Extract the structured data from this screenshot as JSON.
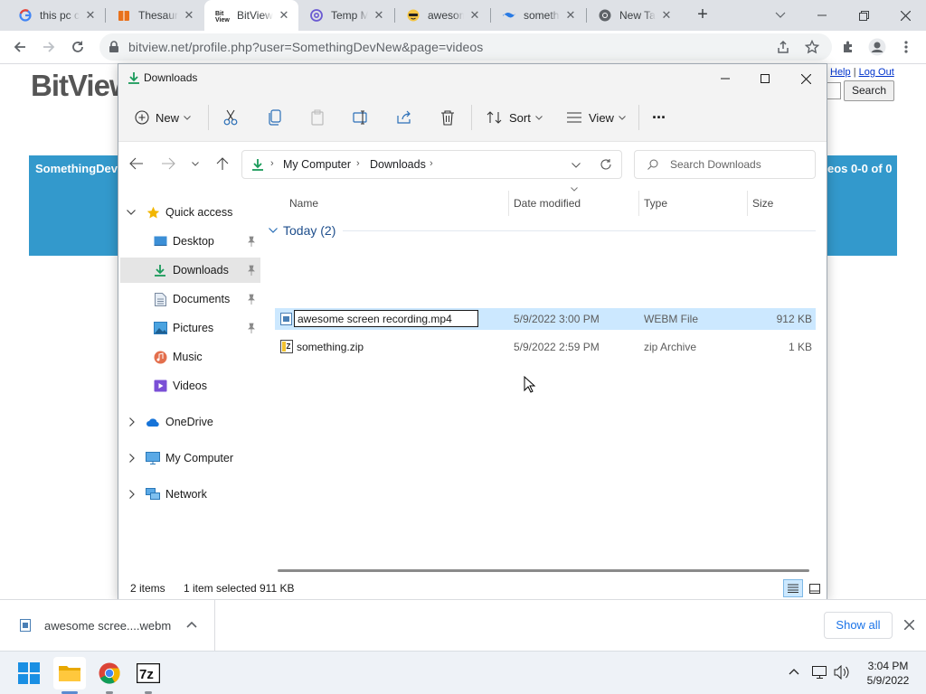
{
  "browser": {
    "tabs": [
      {
        "title": "this pc c",
        "icon": "google-icon"
      },
      {
        "title": "Thesaur",
        "icon": "thesaurus-icon"
      },
      {
        "title": "BitView",
        "icon": "bitview-icon",
        "active": true
      },
      {
        "title": "Temp M",
        "icon": "temp-mail-icon"
      },
      {
        "title": "awesom",
        "icon": "emoji-icon"
      },
      {
        "title": "someth",
        "icon": "swirl-icon"
      },
      {
        "title": "New Tab",
        "icon": "chrome-icon"
      }
    ],
    "new_tab_label": "+",
    "url": "bitview.net/profile.php?user=SomethingDevNew&page=videos"
  },
  "website": {
    "logo": "BitView",
    "help": "Help",
    "separator": "|",
    "logout": "Log Out",
    "search_button": "Search",
    "channel_name": "SomethingDev",
    "videos_count": "eos 0-0 of 0"
  },
  "explorer": {
    "title": "Downloads",
    "commands": {
      "new": "New",
      "sort": "Sort",
      "view": "View",
      "more": "···"
    },
    "breadcrumb": [
      "My Computer",
      "Downloads"
    ],
    "search_placeholder": "Search Downloads",
    "nav": {
      "quick_access": "Quick access",
      "items": [
        "Desktop",
        "Downloads",
        "Documents",
        "Pictures",
        "Music",
        "Videos"
      ],
      "onedrive": "OneDrive",
      "my_computer": "My Computer",
      "network": "Network"
    },
    "columns": {
      "name": "Name",
      "date": "Date modified",
      "type": "Type",
      "size": "Size"
    },
    "group": "Today (2)",
    "files": [
      {
        "name": "awesome screen recording.mp4",
        "date": "5/9/2022 3:00 PM",
        "type": "WEBM File",
        "size": "912 KB",
        "selected": true,
        "renaming": true
      },
      {
        "name": "something.zip",
        "date": "5/9/2022 2:59 PM",
        "type": "zip Archive",
        "size": "1 KB"
      }
    ],
    "status": {
      "items": "2 items",
      "selected": "1 item selected",
      "size": "911 KB"
    }
  },
  "downloads_bar": {
    "file": "awesome scree....webm",
    "show_all": "Show all"
  },
  "taskbar": {
    "time": "3:04 PM",
    "date": "5/9/2022"
  }
}
